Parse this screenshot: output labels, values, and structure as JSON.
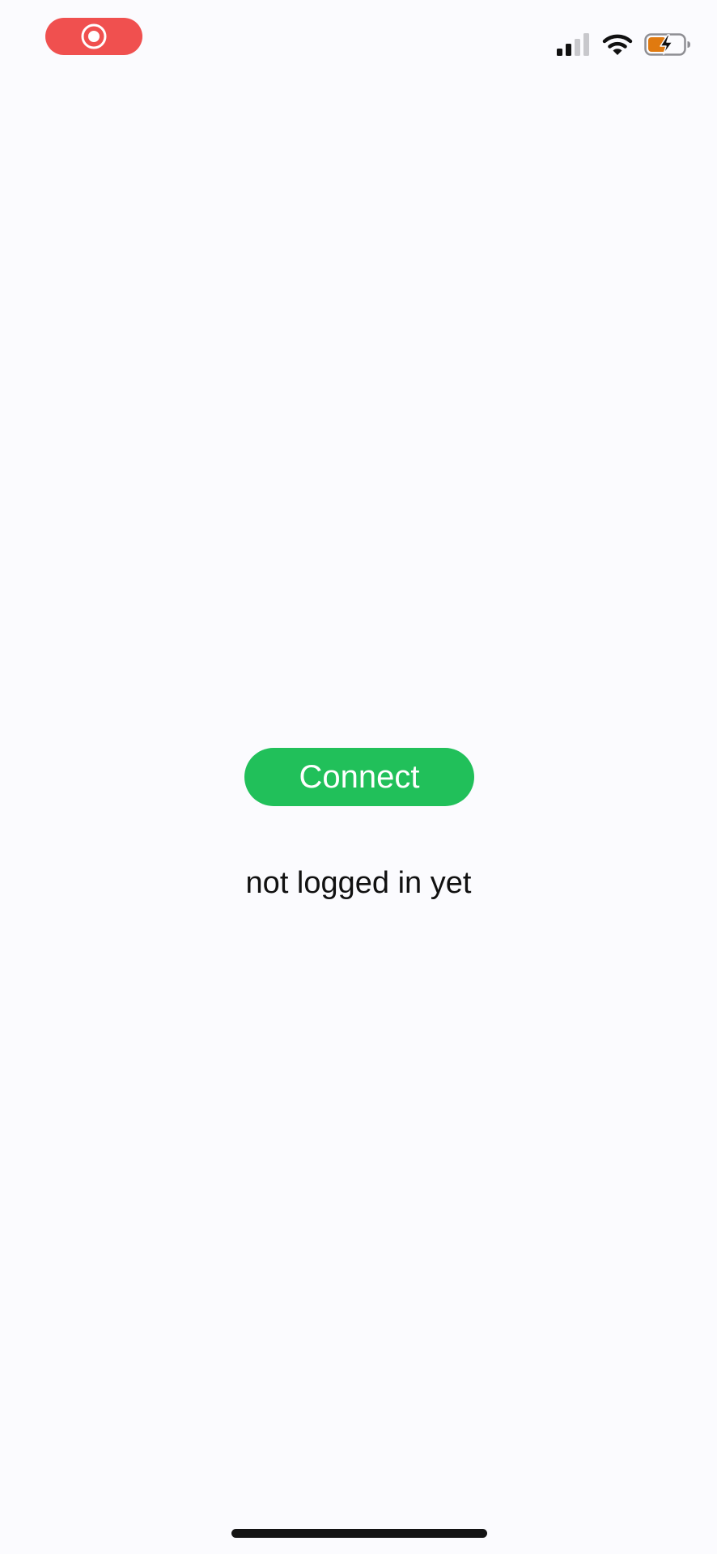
{
  "status_bar": {
    "record_icon": "screen-record-icon",
    "signal_icon": "cellular-signal-icon",
    "wifi_icon": "wifi-icon",
    "battery_icon": "battery-charging-icon",
    "record_color": "#f0504f",
    "battery_fill_color": "#e07a10"
  },
  "main": {
    "connect_label": "Connect",
    "status_message": "not logged in yet",
    "accent_color": "#21c05a"
  }
}
